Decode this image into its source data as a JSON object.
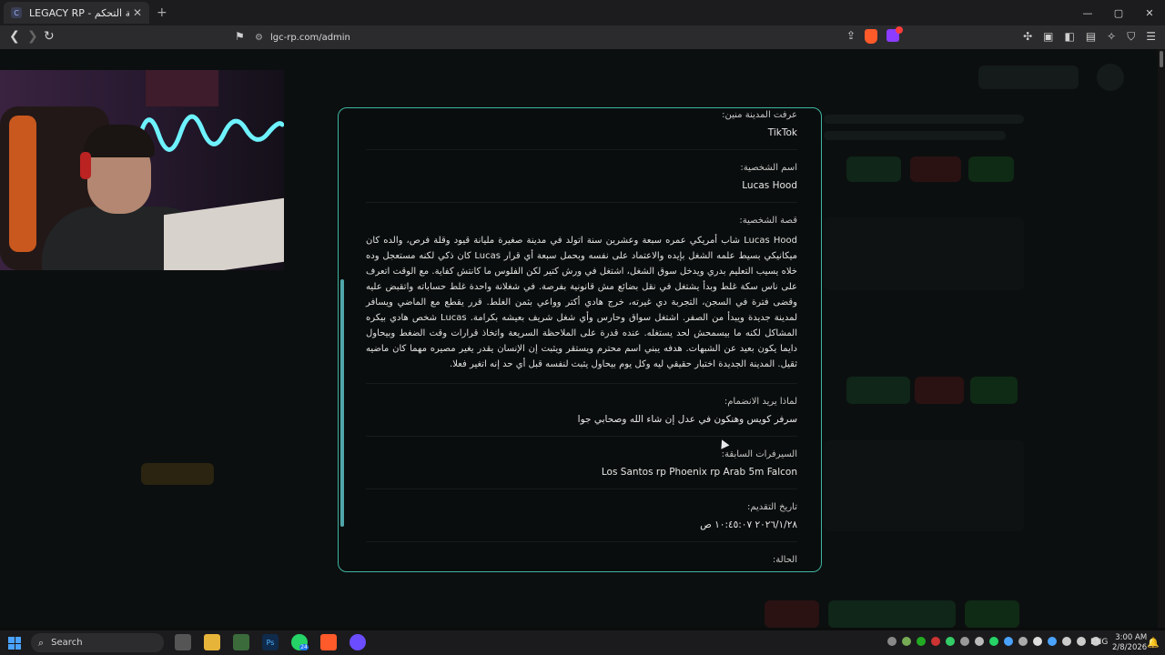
{
  "browser": {
    "tab_title": "LEGACY RP - لوحة التحكم",
    "tab_close": "✕",
    "new_tab": "+",
    "url": "lgc-rp.com/admin",
    "back": "❮",
    "forward": "❯",
    "reload": "↻",
    "window_controls": {
      "minimize": "—",
      "maximize": "▢",
      "close": "✕"
    }
  },
  "modal": {
    "fields": [
      {
        "label": "عرفت المدينة منين:",
        "value": "TikTok"
      },
      {
        "label": "اسم الشخصية:",
        "value": "Lucas Hood"
      },
      {
        "label": "قصة الشخصية:",
        "value": "Lucas Hood شاب أمريكي عمره سبعة وعشرين سنة اتولد في مدينة صغيرة مليانة قيود وقلة فرص، والده كان ميكانيكي بسيط علمه الشغل بإيده والاعتماد على نفسه وبحمل سبعة أي قرار Lucas كان ذكي لكنه مستعجل وده خلاه يسيب التعليم بدري ويدخل سوق الشغل، اشتغل في ورش كتير لكن الفلوس ما كانتش كفاية. مع الوقت اتعرف على ناس سكة غلط وبدأ يشتغل في نقل بضائع مش قانونية بفرصة. في شغلانة واحدة غلط حساباته واتقبض عليه وقضى فترة في السجن، التجربة دي غيرته، خرج هادي أكتر وواعي بثمن الغلط. قرر يقطع مع الماضي ويسافر لمدينة جديدة ويبدأ من الصفر. اشتغل سواق وحارس وأي شغل شريف بعيشه بكرامة. Lucas شخص هادي بيكره المشاكل لكنه ما بيسمحش لحد يستغله. عنده قدرة على الملاحظة السريعة واتخاذ قرارات وقت الضغط وبيحاول دايما يكون بعيد عن الشبهات. هدفه يبني اسم محترم ويستقر ويثبت إن الإنسان يقدر يغير مصيره مهما كان ماضيه ثقيل. المدينة الجديدة اختبار حقيقي ليه وكل يوم بيحاول يثبت لنفسه قبل أي حد إنه اتغير فعلا."
      },
      {
        "label": "لماذا يريد الانضمام:",
        "value": "سرفر كويس وهنكون في عدل إن شاء الله وصحابي جوا"
      },
      {
        "label": "السيرفرات السابقة:",
        "value": "Los Santos rp Phoenix rp Arab 5m Falcon"
      },
      {
        "label": "تاريخ التقديم:",
        "value": "٢٠٢٦/١/٢٨ ١٠:٤٥:٠٧ ص"
      },
      {
        "label": "الحالة:",
        "value": ""
      }
    ]
  },
  "taskbar": {
    "search_label": "Search",
    "lang": "ENG",
    "time": "3:00 AM",
    "date": "2/8/2026",
    "whatsapp_badge": "24"
  },
  "colors": {
    "accent": "#3fb5a4",
    "modal_bg": "#0a0d0d",
    "page_bg": "#0c0f0f"
  }
}
